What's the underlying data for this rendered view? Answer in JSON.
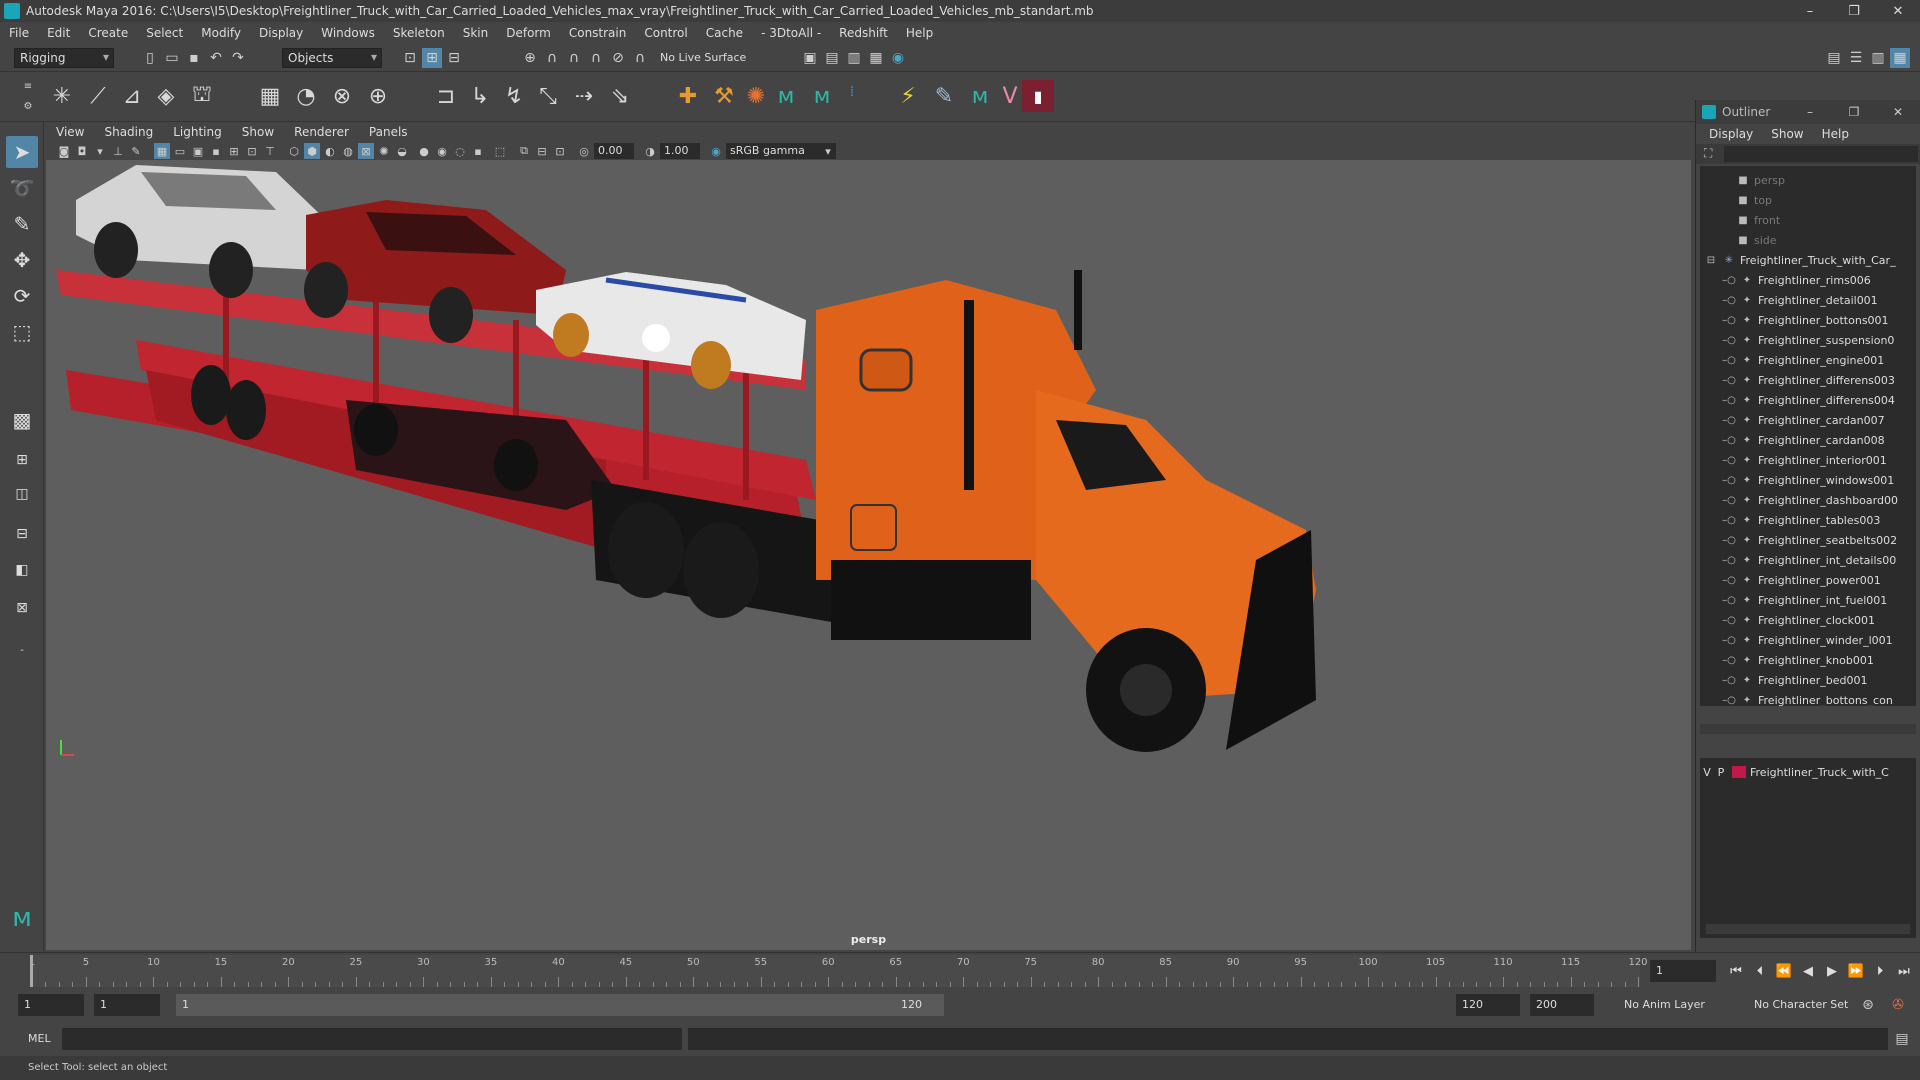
{
  "window": {
    "title": "Autodesk Maya 2016: C:\\Users\\I5\\Desktop\\Freightliner_Truck_with_Car_Carried_Loaded_Vehicles_max_vray\\Freightliner_Truck_with_Car_Carried_Loaded_Vehicles_mb_standart.mb",
    "minimize": "–",
    "restore": "❐",
    "close": "✕"
  },
  "menubar": [
    "File",
    "Edit",
    "Create",
    "Select",
    "Modify",
    "Display",
    "Windows",
    "Skeleton",
    "Skin",
    "Deform",
    "Constrain",
    "Control",
    "Cache",
    "- 3DtoAll -",
    "Redshift",
    "Help"
  ],
  "status_line": {
    "menu_set": "Rigging",
    "selection_mode": "Objects",
    "live_surface": "No Live Surface"
  },
  "viewport": {
    "menu": [
      "View",
      "Shading",
      "Lighting",
      "Show",
      "Renderer",
      "Panels"
    ],
    "exposure": "0.00",
    "gamma": "1.00",
    "color_space": "sRGB gamma",
    "camera_label": "persp"
  },
  "outliner": {
    "title": "Outliner",
    "menu": [
      "Display",
      "Show",
      "Help"
    ],
    "cameras": [
      "persp",
      "top",
      "front",
      "side"
    ],
    "group": "Freightliner_Truck_with_Car_",
    "children": [
      "Freightliner_rims006",
      "Freightliner_detail001",
      "Freightliner_bottons001",
      "Freightliner_suspension0",
      "Freightliner_engine001",
      "Freightliner_differens003",
      "Freightliner_differens004",
      "Freightliner_cardan007",
      "Freightliner_cardan008",
      "Freightliner_interior001",
      "Freightliner_windows001",
      "Freightliner_dashboard00",
      "Freightliner_tables003",
      "Freightliner_seatbelts002",
      "Freightliner_int_details00",
      "Freightliner_power001",
      "Freightliner_int_fuel001",
      "Freightliner_clock001",
      "Freightliner_winder_l001",
      "Freightliner_knob001",
      "Freightliner_bed001",
      "Freightliner_bottons_con"
    ]
  },
  "layer": {
    "v": "V",
    "p": "P",
    "name": "Freightliner_Truck_with_C",
    "color": "#c2184a"
  },
  "timeline": {
    "labels": [
      "1",
      "5",
      "10",
      "15",
      "20",
      "25",
      "30",
      "35",
      "40",
      "45",
      "50",
      "55",
      "60",
      "65",
      "70",
      "75",
      "80",
      "85",
      "90",
      "95",
      "100",
      "105",
      "110",
      "115",
      "120"
    ],
    "current_frame": "1"
  },
  "range": {
    "start": "1",
    "playback_start": "1",
    "slider_start": "1",
    "slider_end": "120",
    "playback_end": "120",
    "end": "200",
    "anim_layer": "No Anim Layer",
    "character_set": "No Character Set"
  },
  "command": {
    "label": "MEL"
  },
  "help_line": "Select Tool: select an object"
}
